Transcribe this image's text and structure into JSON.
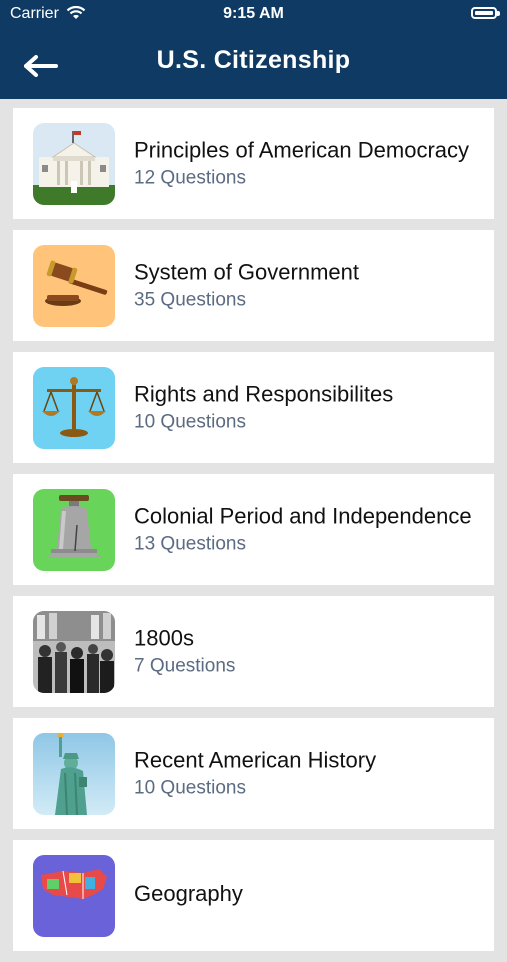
{
  "status_bar": {
    "carrier": "Carrier",
    "time": "9:15 AM"
  },
  "header": {
    "title": "U.S. Citizenship"
  },
  "categories": [
    {
      "title": "Principles of American Democracy",
      "count": "12 Questions",
      "icon": "white-house-icon",
      "color": "#cfe3ef"
    },
    {
      "title": "System of Government",
      "count": "35 Questions",
      "icon": "gavel-icon",
      "color": "#ffc47a"
    },
    {
      "title": "Rights and Responsibilites",
      "count": "10 Questions",
      "icon": "scales-icon",
      "color": "#6fd2f3"
    },
    {
      "title": "Colonial Period and Independence",
      "count": "13 Questions",
      "icon": "liberty-bell-icon",
      "color": "#69d45a"
    },
    {
      "title": "1800s",
      "count": "7 Questions",
      "icon": "historic-crowd-icon",
      "color": "#8a8a8a"
    },
    {
      "title": "Recent American History",
      "count": "10 Questions",
      "icon": "statue-of-liberty-icon",
      "color": "#a7d4ea"
    },
    {
      "title": "Geography",
      "count": "",
      "icon": "us-map-icon",
      "color": "#6a62d8"
    }
  ]
}
